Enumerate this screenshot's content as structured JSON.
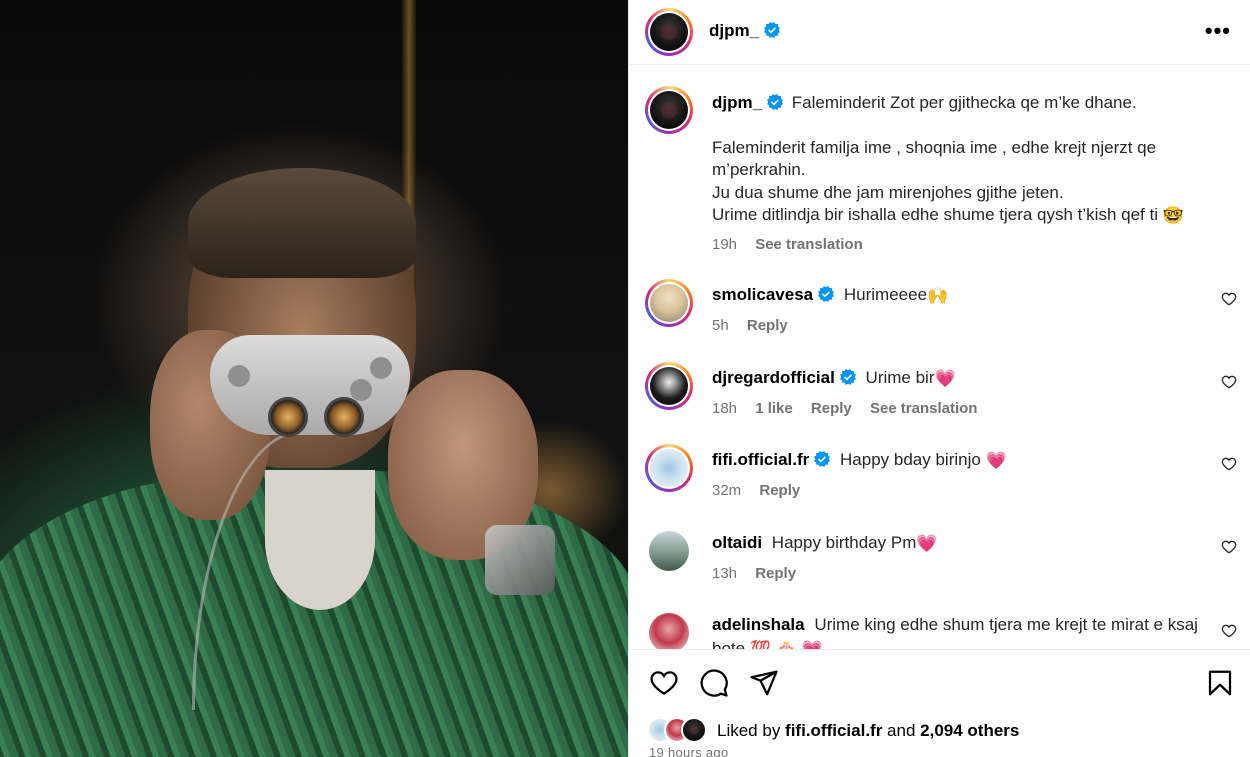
{
  "post": {
    "username": "djpm_",
    "verified": true,
    "more_label": "•••"
  },
  "caption": {
    "username": "djpm_",
    "line1": "Faleminderit Zot per gjithecka qe m’ke dhane.",
    "line2": "Faleminderit familja ime , shoqnia ime , edhe krejt njerzt qe m’perkrahin.",
    "line3": "Ju dua shume dhe jam mirenjohes gjithe jeten.",
    "line4": "Urime ditlindja bir ishalla edhe shume tjera qysh t’kish qef ti",
    "time": "19h",
    "see_translation": "See translation"
  },
  "comments": [
    {
      "username": "smolicavesa",
      "verified": true,
      "text": "Hurimeeee",
      "emoji": "🙌",
      "time": "5h",
      "likes": "",
      "reply": "Reply",
      "translation": ""
    },
    {
      "username": "djregardofficial",
      "verified": true,
      "text": "Urime bir",
      "emoji": "💗",
      "time": "18h",
      "likes": "1 like",
      "reply": "Reply",
      "translation": "See translation"
    },
    {
      "username": "fifi.official.fr",
      "verified": true,
      "text": "Happy bday birinjo ",
      "emoji": "💗",
      "time": "32m",
      "likes": "",
      "reply": "Reply",
      "translation": ""
    },
    {
      "username": "oltaidi",
      "verified": false,
      "text": "Happy birthday Pm",
      "emoji": "💗",
      "time": "13h",
      "likes": "",
      "reply": "Reply",
      "translation": ""
    },
    {
      "username": "adelinshala",
      "verified": false,
      "text": "Urime king edhe shum tjera me krejt te mirat e ksaj",
      "text2": "bote",
      "emoji": "💯 🎂 💗",
      "time": "",
      "likes": "",
      "reply": "",
      "translation": ""
    }
  ],
  "likes": {
    "prefix": "Liked by ",
    "user": "fifi.official.fr",
    "and": " and ",
    "others": "2,094 others"
  },
  "timeago": "19 hours ago",
  "colors": {
    "verified": "#0095f6",
    "muted": "#737373",
    "divider": "#efefef"
  },
  "icons": {
    "like": "heart-icon",
    "comment": "comment-icon",
    "share": "share-icon",
    "save": "bookmark-icon"
  }
}
